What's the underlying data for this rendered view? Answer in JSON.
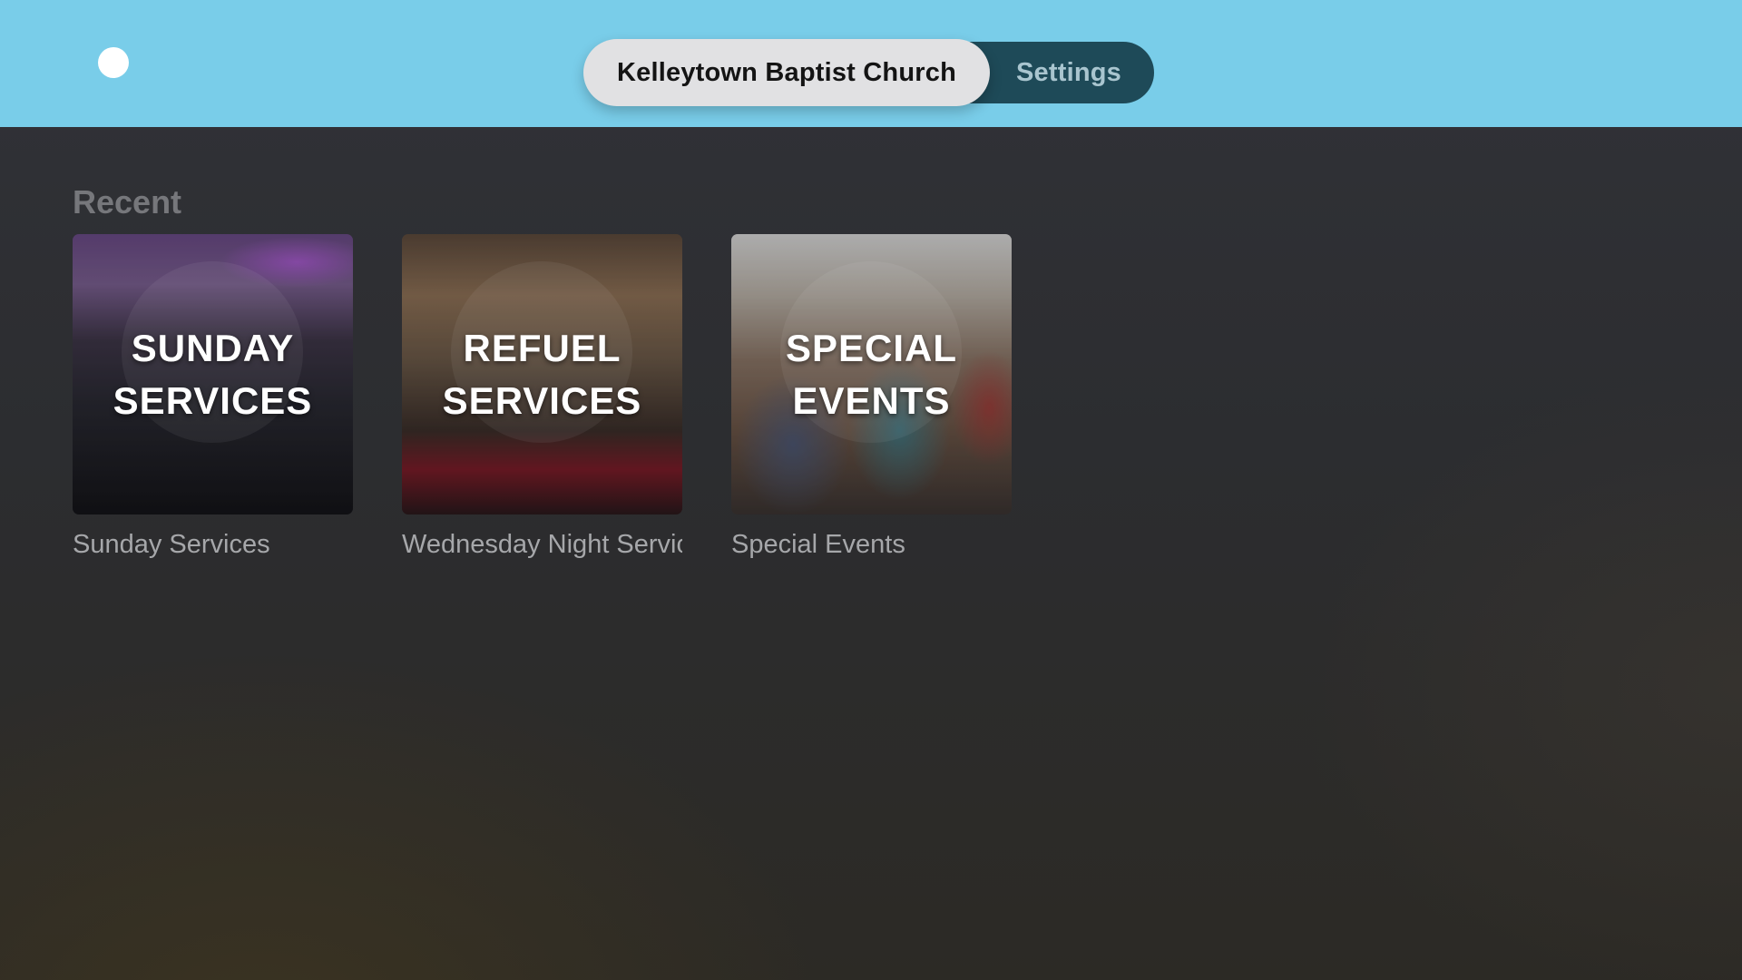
{
  "topbar": {
    "tabs": [
      {
        "label": "Kelleytown Baptist Church",
        "selected": true
      },
      {
        "label": "Settings",
        "selected": false
      }
    ]
  },
  "recent": {
    "heading": "Recent",
    "items": [
      {
        "art_lines": [
          "SUNDAY",
          "SERVICES"
        ],
        "caption": "Sunday Services"
      },
      {
        "art_lines": [
          "REFUEL",
          "SERVICES"
        ],
        "caption": "Wednesday Night Services"
      },
      {
        "art_lines": [
          "SPECIAL",
          "EVENTS"
        ],
        "caption": "Special Events"
      }
    ]
  },
  "colors": {
    "topbar_background": "#79cde9",
    "tabbar_background": "#1e4a58",
    "selected_tab_background": "#e1e1e3",
    "page_background": "#2e2f33"
  }
}
